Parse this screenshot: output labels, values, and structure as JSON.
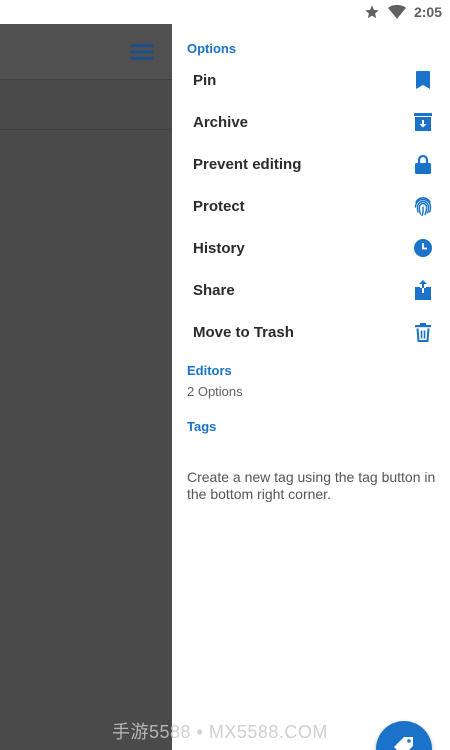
{
  "status_bar": {
    "time": "2:05",
    "icons": [
      "star-icon",
      "wifi-icon"
    ]
  },
  "background_app": {
    "icons": [
      "menu-icon"
    ]
  },
  "drawer": {
    "options_title": "Options",
    "items": [
      {
        "label": "Pin",
        "icon": "bookmark-icon"
      },
      {
        "label": "Archive",
        "icon": "archive-icon"
      },
      {
        "label": "Prevent editing",
        "icon": "lock-icon"
      },
      {
        "label": "Protect",
        "icon": "fingerprint-icon"
      },
      {
        "label": "History",
        "icon": "clock-icon"
      },
      {
        "label": "Share",
        "icon": "share-icon"
      },
      {
        "label": "Move to Trash",
        "icon": "trash-icon"
      }
    ],
    "editors_title": "Editors",
    "editors_value": "2 Options",
    "tags_title": "Tags",
    "tags_hint": "Create a new tag using the tag button in the bottom right corner."
  },
  "fab": {
    "icon": "tag-icon"
  },
  "watermark": "手游5588 • MX5588.COM",
  "colors": {
    "accent": "#1a73c8",
    "scrim": "#4a4a4a",
    "text_primary": "#2b2b2b",
    "text_secondary": "#616161"
  }
}
